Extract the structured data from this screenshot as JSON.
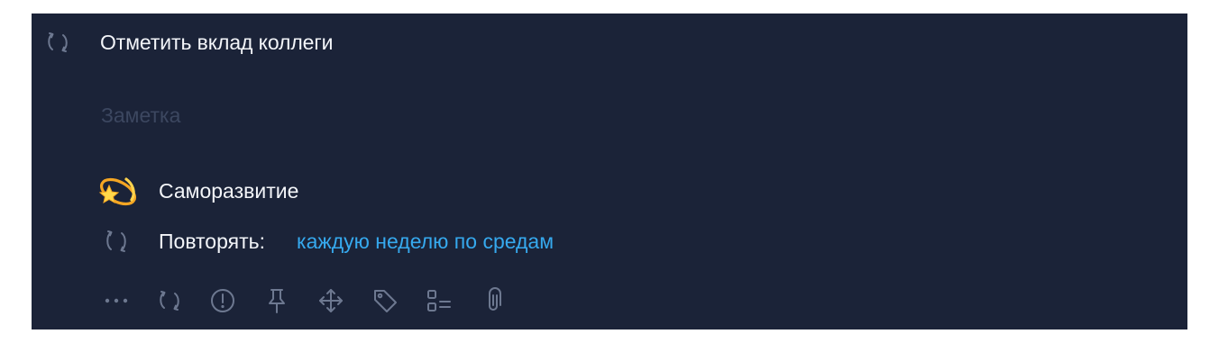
{
  "task": {
    "title": "Отметить вклад коллеги",
    "repeat_icon": "repeat-icon"
  },
  "note": {
    "placeholder": "Заметка"
  },
  "category": {
    "emoji": "💫",
    "label": "Саморазвитие"
  },
  "repeat": {
    "label": "Повторять:",
    "value": "каждую неделю по средам"
  },
  "toolbar": {
    "items": [
      {
        "icon": "more-icon"
      },
      {
        "icon": "repeat-icon"
      },
      {
        "icon": "priority-icon"
      },
      {
        "icon": "pin-icon"
      },
      {
        "icon": "move-icon"
      },
      {
        "icon": "tag-icon"
      },
      {
        "icon": "checklist-icon"
      },
      {
        "icon": "attachment-icon"
      }
    ]
  },
  "colors": {
    "background": "#1b2338",
    "text": "#f3f5f9",
    "muted": "#3c4760",
    "icon": "#6d7890",
    "accent": "#36a9ee"
  }
}
